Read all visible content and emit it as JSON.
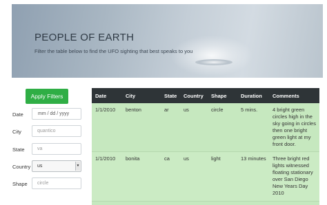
{
  "header": {
    "title": "PEOPLE OF EARTH",
    "subtitle": "Filter the table below to find the UFO sighting that best speaks to you"
  },
  "filters": {
    "apply_label": "Apply Filters",
    "date": {
      "label": "Date",
      "placeholder": "mm / dd / yyyy"
    },
    "city": {
      "label": "City",
      "placeholder": "quantico"
    },
    "state": {
      "label": "State",
      "placeholder": "va"
    },
    "country": {
      "label": "Country",
      "selected": "us"
    },
    "shape": {
      "label": "Shape",
      "placeholder": "circle"
    }
  },
  "table": {
    "columns": [
      "Date",
      "City",
      "State",
      "Country",
      "Shape",
      "Duration",
      "Comments"
    ],
    "rows": [
      {
        "date": "1/1/2010",
        "city": "benton",
        "state": "ar",
        "country": "us",
        "shape": "circle",
        "duration": "5 mins.",
        "comments": "4 bright green circles high in the sky going in circles then one bright green light at my front door."
      },
      {
        "date": "1/1/2010",
        "city": "bonita",
        "state": "ca",
        "country": "us",
        "shape": "light",
        "duration": "13 minutes",
        "comments": "Three bright red lights witnessed floating stationary over San Diego New Years Day 2010"
      }
    ]
  },
  "colors": {
    "accent_button": "#2fae45",
    "table_header": "#2e3437",
    "row_background": "#c6e8bf"
  }
}
